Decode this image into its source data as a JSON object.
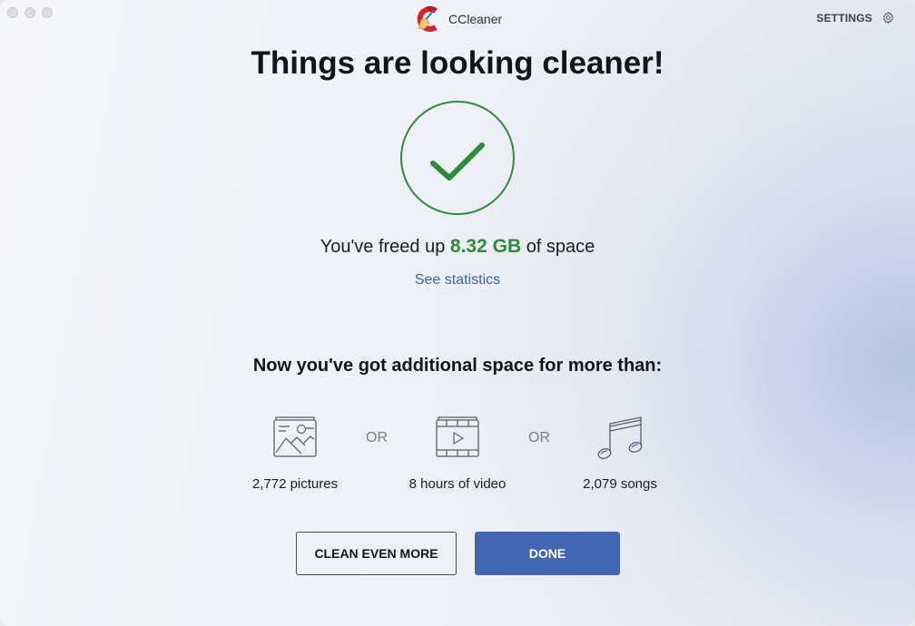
{
  "window": {
    "app_name": "CCleaner",
    "settings_label": "SETTINGS"
  },
  "result": {
    "headline": "Things are looking cleaner!",
    "freed_prefix": "You've freed up",
    "freed_amount": "8.32 GB",
    "freed_suffix": "of space",
    "see_statistics": "See statistics"
  },
  "equivalents": {
    "heading": "Now you've got additional space for more than:",
    "separator": "OR",
    "items": [
      {
        "icon": "image-icon",
        "label": "2,772 pictures"
      },
      {
        "icon": "video-icon",
        "label": "8 hours of video"
      },
      {
        "icon": "music-note-icon",
        "label": "2,079 songs"
      }
    ]
  },
  "actions": {
    "clean_more": "CLEAN EVEN MORE",
    "done": "DONE"
  },
  "colors": {
    "success_green": "#2e8b3a",
    "link_blue": "#4061ad",
    "primary_button": "#4366b3"
  }
}
